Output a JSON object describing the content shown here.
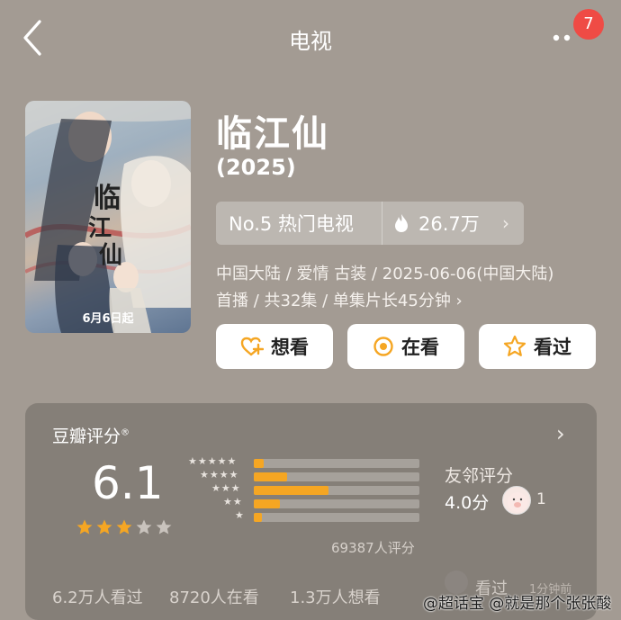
{
  "header": {
    "title": "电视",
    "notification_count": "7"
  },
  "show": {
    "title": "临江仙",
    "year": "(2025)",
    "poster_caption": "6月6日起",
    "rank": "No.5 热门电视",
    "heat": "26.7万",
    "meta_line1": "中国大陆 / 爱情 古装 / 2025-06-06(中国大陆)",
    "meta_line2": "首播 / 共32集 / 单集片长45分钟 ›"
  },
  "actions": {
    "want": "想看",
    "watching": "在看",
    "watched": "看过"
  },
  "rating": {
    "title": "豆瓣评分",
    "score": "6.1",
    "stars_filled": 3,
    "stars_total": 5,
    "distribution": [
      {
        "stars": 5,
        "fraction": 0.06
      },
      {
        "stars": 4,
        "fraction": 0.2
      },
      {
        "stars": 3,
        "fraction": 0.45
      },
      {
        "stars": 2,
        "fraction": 0.16
      },
      {
        "stars": 1,
        "fraction": 0.05
      }
    ],
    "votes": "69387人评分",
    "friend_label": "友邻评分",
    "friend_score": "4.0分",
    "friend_count": "1",
    "stats": [
      "6.2万人看过",
      "8720人在看",
      "1.3万人想看"
    ],
    "recent_action": "看过",
    "recent_time": "1分钟前"
  },
  "watermark": "@超话宝 @就是那个张张酸",
  "colors": {
    "background": "#a39b93",
    "accent_orange": "#f5a623",
    "badge_red": "#ef4b45"
  },
  "icons": [
    "back-arrow-icon",
    "more-dots-icon",
    "flame-icon",
    "heart-plus-icon",
    "target-circle-icon",
    "star-outline-icon",
    "chevron-right-icon"
  ]
}
